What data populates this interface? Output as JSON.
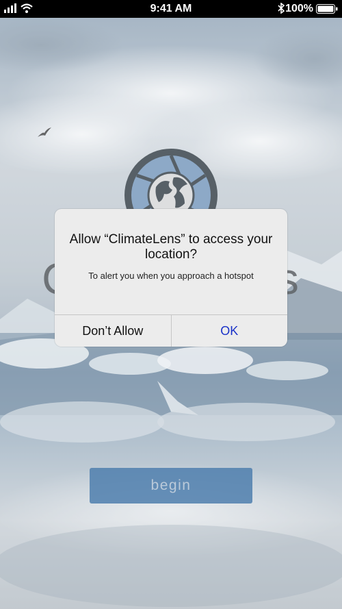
{
  "status_bar": {
    "time": "9:41 AM",
    "battery_percent": "100%",
    "icons": [
      "signal-icon",
      "wifi-icon",
      "bluetooth-icon",
      "battery-icon"
    ]
  },
  "background": {
    "app_title": "ClimateLens",
    "begin_label": "begin",
    "colors": {
      "begin_button": "#4f7fae",
      "sky": "#b9c4cc"
    }
  },
  "alert": {
    "title": "Allow “ClimateLens” to access your location?",
    "message": "To alert you when you approach a hotspot",
    "deny_label": "Don’t Allow",
    "ok_label": "OK",
    "colors": {
      "ok_text": "#1a32c8",
      "background": "#ececec"
    }
  }
}
